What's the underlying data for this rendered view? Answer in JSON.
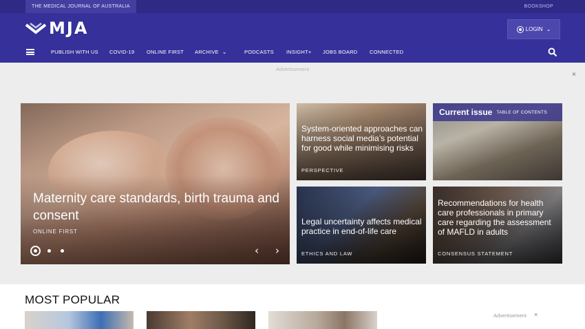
{
  "topbar": {
    "journal_name": "THE MEDICAL JOURNAL OF AUSTRALIA",
    "bookshop": "BOOKSHOP"
  },
  "header": {
    "logo_text": "MJA",
    "login_label": "LOGIN"
  },
  "nav": {
    "items": [
      "PUBLISH WITH US",
      "COVID-19",
      "ONLINE FIRST",
      "ARCHIVE",
      "PODCASTS",
      "INSIGHT+",
      "JOBS BOARD",
      "CONNECTED"
    ]
  },
  "ad": {
    "label": "Advertisement",
    "close": "×"
  },
  "hero": {
    "title": "Maternity care standards, birth trauma and consent",
    "category": "ONLINE FIRST",
    "prev": "‹",
    "next": "›"
  },
  "cards": [
    {
      "title": "System-oriented approaches can harness social media’s potential for good while minimising risks",
      "category": "PERSPECTIVE"
    },
    {
      "current_issue": "Current issue",
      "toc": "TABLE OF CONTENTS"
    },
    {
      "title": "Legal uncertainty affects medical practice in end-of-life care",
      "category": "ETHICS AND LAW"
    },
    {
      "title": "Recommendations for health care professionals in primary care regarding the assessment of MAFLD in adults",
      "category": "CONSENSUS STATEMENT"
    }
  ],
  "most_popular": {
    "heading": "MOST POPULAR",
    "ad_label": "Advertisement",
    "ad_close": "×"
  },
  "colors": {
    "header_bg": "#35309a",
    "topstrip_bg": "#2e2a86"
  }
}
